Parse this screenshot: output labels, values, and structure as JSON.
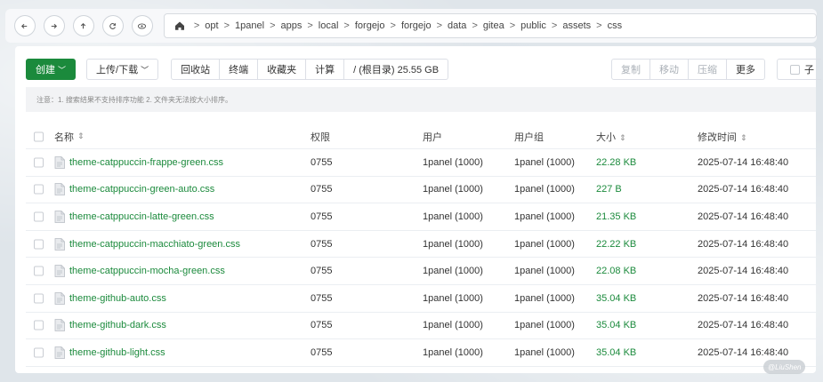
{
  "nav": {
    "buttons": [
      "back-icon",
      "forward-icon",
      "up-icon",
      "refresh-icon",
      "eye-icon"
    ]
  },
  "path": {
    "crumbs": [
      "opt",
      "1panel",
      "apps",
      "local",
      "forgejo",
      "forgejo",
      "data",
      "gitea",
      "public",
      "assets",
      "css"
    ],
    "separator": ">"
  },
  "toolbar": {
    "create_label": "创建",
    "upload_label": "上传/下载",
    "recycle_label": "回收站",
    "terminal_label": "终端",
    "favorites_label": "收藏夹",
    "calc_label": "计算",
    "root_size_label": "/ (根目录) 25.55 GB",
    "copy_label": "复制",
    "move_label": "移动",
    "compress_label": "压缩",
    "more_label": "更多",
    "child_label": "子"
  },
  "notice": "注意：1. 搜索结果不支持排序功能 2. 文件夹无法按大小排序。",
  "table": {
    "headers": {
      "name": "名称",
      "perm": "权限",
      "user": "用户",
      "group": "用户组",
      "size": "大小",
      "time": "修改时间",
      "sort_icon": "⇕"
    },
    "rows": [
      {
        "name": "theme-catppuccin-frappe-green.css",
        "perm": "0755",
        "user": "1panel (1000)",
        "group": "1panel (1000)",
        "size": "22.28 KB",
        "time": "2025-07-14 16:48:40"
      },
      {
        "name": "theme-catppuccin-green-auto.css",
        "perm": "0755",
        "user": "1panel (1000)",
        "group": "1panel (1000)",
        "size": "227 B",
        "time": "2025-07-14 16:48:40"
      },
      {
        "name": "theme-catppuccin-latte-green.css",
        "perm": "0755",
        "user": "1panel (1000)",
        "group": "1panel (1000)",
        "size": "21.35 KB",
        "time": "2025-07-14 16:48:40"
      },
      {
        "name": "theme-catppuccin-macchiato-green.css",
        "perm": "0755",
        "user": "1panel (1000)",
        "group": "1panel (1000)",
        "size": "22.22 KB",
        "time": "2025-07-14 16:48:40"
      },
      {
        "name": "theme-catppuccin-mocha-green.css",
        "perm": "0755",
        "user": "1panel (1000)",
        "group": "1panel (1000)",
        "size": "22.08 KB",
        "time": "2025-07-14 16:48:40"
      },
      {
        "name": "theme-github-auto.css",
        "perm": "0755",
        "user": "1panel (1000)",
        "group": "1panel (1000)",
        "size": "35.04 KB",
        "time": "2025-07-14 16:48:40"
      },
      {
        "name": "theme-github-dark.css",
        "perm": "0755",
        "user": "1panel (1000)",
        "group": "1panel (1000)",
        "size": "35.04 KB",
        "time": "2025-07-14 16:48:40"
      },
      {
        "name": "theme-github-light.css",
        "perm": "0755",
        "user": "1panel (1000)",
        "group": "1panel (1000)",
        "size": "35.04 KB",
        "time": "2025-07-14 16:48:40"
      }
    ]
  },
  "watermark": "@LiuShen",
  "colors": {
    "accent": "#1b8a3c"
  }
}
